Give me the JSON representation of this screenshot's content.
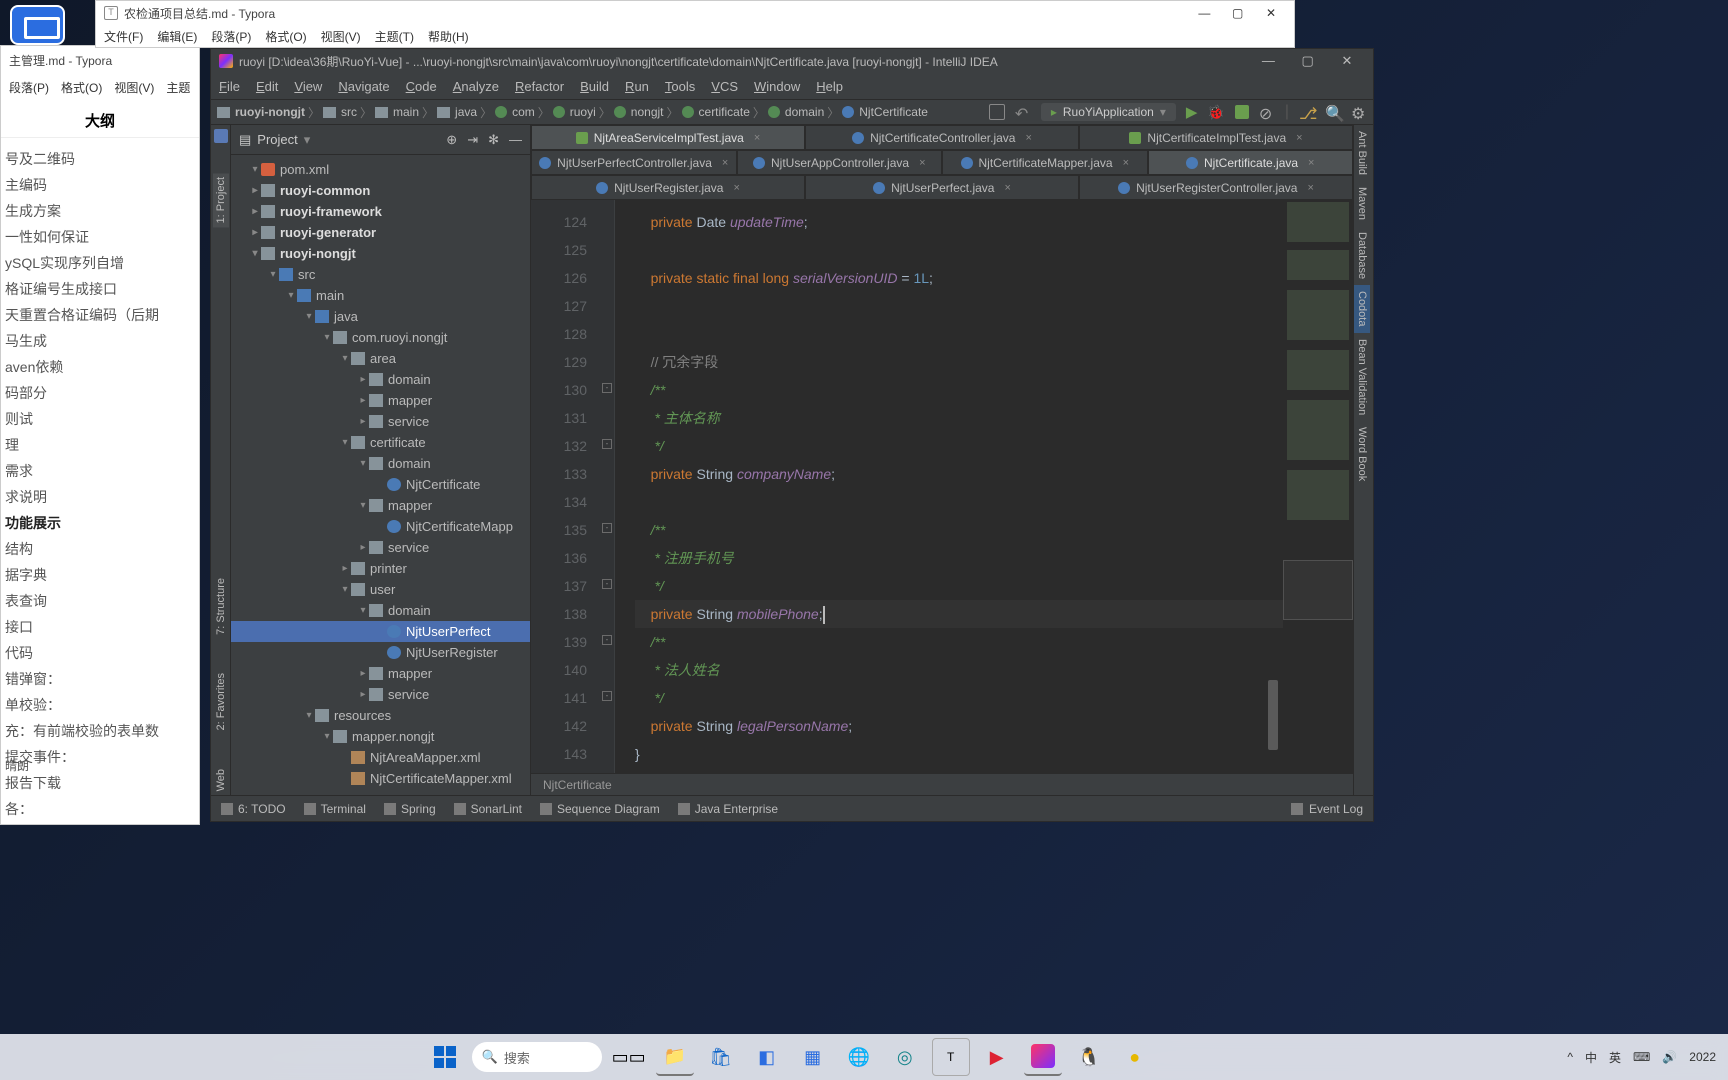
{
  "typora_back": {
    "title": "主管理.md - Typora",
    "menu": [
      "段落(P)",
      "格式(O)",
      "视图(V)",
      "主题"
    ],
    "outline_heading": "大纲",
    "items": [
      "号及二维码",
      "主编码",
      "生成方案",
      "一性如何保证",
      "ySQL实现序列自增",
      "格证编号生成接口",
      "天重置合格证编码（后期",
      "马生成",
      "aven依赖",
      "码部分",
      "则试",
      "理",
      "需求",
      "求说明",
      "功能展示",
      "结构",
      "据字典",
      "表查询",
      "接口",
      "代码",
      "错弹窗：",
      "单校验：",
      "充：有前端校验的表单数",
      "提交事件：",
      "报告下载",
      "各："
    ],
    "footer": "晴朗"
  },
  "typora_front": {
    "title": "农检通项目总结.md - Typora",
    "menu": [
      "文件(F)",
      "编辑(E)",
      "段落(P)",
      "格式(O)",
      "视图(V)",
      "主题(T)",
      "帮助(H)"
    ]
  },
  "ij": {
    "title": "ruoyi [D:\\idea\\36期\\RuoYi-Vue] - ...\\ruoyi-nongjt\\src\\main\\java\\com\\ruoyi\\nongjt\\certificate\\domain\\NjtCertificate.java [ruoyi-nongjt] - IntelliJ IDEA",
    "menu": [
      "File",
      "Edit",
      "View",
      "Navigate",
      "Code",
      "Analyze",
      "Refactor",
      "Build",
      "Run",
      "Tools",
      "VCS",
      "Window",
      "Help"
    ],
    "breadcrumb": [
      "ruoyi-nongjt",
      "src",
      "main",
      "java",
      "com",
      "ruoyi",
      "nongjt",
      "certificate",
      "domain",
      "NjtCertificate"
    ],
    "run_config": "RuoYiApplication",
    "project": {
      "heading": "Project"
    },
    "tree": [
      {
        "d": 1,
        "t": "down",
        "ic": "mvn",
        "label": "pom.xml",
        "leaf": true
      },
      {
        "d": 1,
        "t": "right",
        "ic": "fldr",
        "label": "ruoyi-common",
        "bold": true
      },
      {
        "d": 1,
        "t": "right",
        "ic": "fldr",
        "label": "ruoyi-framework",
        "bold": true
      },
      {
        "d": 1,
        "t": "right",
        "ic": "fldr",
        "label": "ruoyi-generator",
        "bold": true
      },
      {
        "d": 1,
        "t": "down",
        "ic": "fldr",
        "label": "ruoyi-nongjt",
        "bold": true
      },
      {
        "d": 2,
        "t": "down",
        "ic": "fldr-b",
        "label": "src"
      },
      {
        "d": 3,
        "t": "down",
        "ic": "fldr-b",
        "label": "main"
      },
      {
        "d": 4,
        "t": "down",
        "ic": "fldr-b",
        "label": "java"
      },
      {
        "d": 5,
        "t": "down",
        "ic": "fldr",
        "label": "com.ruoyi.nongjt"
      },
      {
        "d": 6,
        "t": "down",
        "ic": "fldr",
        "label": "area"
      },
      {
        "d": 7,
        "t": "right",
        "ic": "fldr",
        "label": "domain"
      },
      {
        "d": 7,
        "t": "right",
        "ic": "fldr",
        "label": "mapper"
      },
      {
        "d": 7,
        "t": "right",
        "ic": "fldr",
        "label": "service"
      },
      {
        "d": 6,
        "t": "down",
        "ic": "fldr",
        "label": "certificate"
      },
      {
        "d": 7,
        "t": "down",
        "ic": "fldr",
        "label": "domain"
      },
      {
        "d": 8,
        "t": "",
        "ic": "java",
        "label": "NjtCertificate",
        "leaf": true
      },
      {
        "d": 7,
        "t": "down",
        "ic": "fldr",
        "label": "mapper"
      },
      {
        "d": 8,
        "t": "",
        "ic": "java",
        "label": "NjtCertificateMapp",
        "leaf": true
      },
      {
        "d": 7,
        "t": "right",
        "ic": "fldr",
        "label": "service"
      },
      {
        "d": 6,
        "t": "right",
        "ic": "fldr",
        "label": "printer"
      },
      {
        "d": 6,
        "t": "down",
        "ic": "fldr",
        "label": "user"
      },
      {
        "d": 7,
        "t": "down",
        "ic": "fldr",
        "label": "domain"
      },
      {
        "d": 8,
        "t": "",
        "ic": "java",
        "label": "NjtUserPerfect",
        "leaf": true,
        "sel": true
      },
      {
        "d": 8,
        "t": "",
        "ic": "java",
        "label": "NjtUserRegister",
        "leaf": true
      },
      {
        "d": 7,
        "t": "right",
        "ic": "fldr",
        "label": "mapper"
      },
      {
        "d": 7,
        "t": "right",
        "ic": "fldr",
        "label": "service"
      },
      {
        "d": 4,
        "t": "down",
        "ic": "fldr",
        "label": "resources"
      },
      {
        "d": 5,
        "t": "down",
        "ic": "fldr",
        "label": "mapper.nongjt"
      },
      {
        "d": 6,
        "t": "",
        "ic": "xml",
        "label": "NjtAreaMapper.xml",
        "leaf": true
      },
      {
        "d": 6,
        "t": "",
        "ic": "xml",
        "label": "NjtCertificateMapper.xml",
        "leaf": true
      }
    ],
    "left_tool": "1: Project",
    "left_tools_lower": [
      "7: Structure",
      "2: Favorites",
      "Web"
    ],
    "right_tools": [
      "Ant Build",
      "Maven",
      "Database",
      "Codota",
      "Bean Validation",
      "Word Book"
    ],
    "tabs_r1": [
      {
        "ic": "t",
        "label": "NjtAreaServiceImplTest.java",
        "sel": true
      },
      {
        "ic": "j",
        "label": "NjtCertificateController.java"
      },
      {
        "ic": "t",
        "label": "NjtCertificateImplTest.java"
      }
    ],
    "tabs_r2": [
      {
        "ic": "j",
        "label": "NjtUserPerfectController.java"
      },
      {
        "ic": "j",
        "label": "NjtUserAppController.java"
      },
      {
        "ic": "j",
        "label": "NjtCertificateMapper.java"
      },
      {
        "ic": "j",
        "label": "NjtCertificate.java",
        "sel": true
      }
    ],
    "tabs_r3": [
      {
        "ic": "j",
        "label": "NjtUserRegister.java"
      },
      {
        "ic": "j",
        "label": "NjtUserPerfect.java"
      },
      {
        "ic": "j",
        "label": "NjtUserRegisterController.java"
      }
    ],
    "line_start": 124,
    "code_lines": [
      {
        "html": "    <span class='kw'>private</span> Date <span class='fld'>updateTime</span>;"
      },
      {
        "html": ""
      },
      {
        "html": "    <span class='kw'>private static final long</span> <span class='fld'>serialVersionUID</span> = <span class='num'>1L</span>;"
      },
      {
        "html": ""
      },
      {
        "html": ""
      },
      {
        "html": "    <span class='cm'>// 冗余字段</span>"
      },
      {
        "html": "    <span class='jd'>/**</span>"
      },
      {
        "html": "    <span class='jd'> * 主体名称</span>"
      },
      {
        "html": "    <span class='jd'> */</span>"
      },
      {
        "html": "    <span class='kw'>private</span> String <span class='fld'>companyName</span>;"
      },
      {
        "html": ""
      },
      {
        "html": "    <span class='jd'>/**</span>"
      },
      {
        "html": "    <span class='jd'> * 注册手机号</span>"
      },
      {
        "html": "    <span class='jd'> */</span>"
      },
      {
        "html": "    <span class='kw'>private</span> String <span class='fld'>mobilePhone</span>;<span class='caret'></span>",
        "cur": true
      },
      {
        "html": "    <span class='jd'>/**</span>"
      },
      {
        "html": "    <span class='jd'> * 法人姓名</span>"
      },
      {
        "html": "    <span class='jd'> */</span>"
      },
      {
        "html": "    <span class='kw'>private</span> String <span class='fld'>legalPersonName</span>;"
      },
      {
        "html": "}"
      }
    ],
    "ed_breadcrumb": "NjtCertificate",
    "status_tools": [
      {
        "ic": "todo",
        "label": "6: TODO"
      },
      {
        "ic": "term",
        "label": "Terminal"
      },
      {
        "ic": "spring",
        "label": "Spring"
      },
      {
        "ic": "sonar",
        "label": "SonarLint"
      },
      {
        "ic": "seq",
        "label": "Sequence Diagram"
      },
      {
        "ic": "jee",
        "label": "Java Enterprise"
      }
    ],
    "event_log": "Event Log"
  },
  "taskbar": {
    "search": "搜索",
    "tray": [
      "^",
      "中",
      "英",
      "⌨",
      "🔊"
    ],
    "year": "2022"
  }
}
